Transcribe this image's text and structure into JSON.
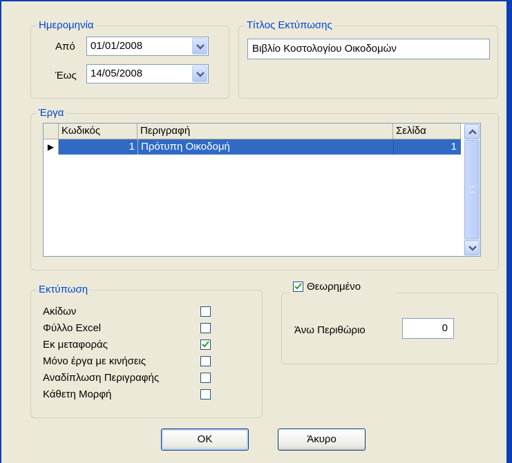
{
  "date_group": {
    "legend": "Ημερομηνία",
    "from_label": "Από",
    "from_value": "01/01/2008",
    "to_label": "Έως",
    "to_value": "14/05/2008"
  },
  "title_group": {
    "legend": "Τίτλος Εκτύπωσης",
    "value": "Βιβλίο Κοστολογίου Οικοδομών"
  },
  "projects_group": {
    "legend": "Έργα",
    "columns": [
      "Κωδικός",
      "Περιγραφή",
      "Σελίδα"
    ],
    "rows": [
      {
        "code": "1",
        "description": "Πρότυπη Οικοδομή",
        "page": "1"
      }
    ],
    "row_indicator": "▶"
  },
  "print_group": {
    "legend": "Εκτύπωση",
    "options": [
      {
        "label": "Ακίδων",
        "checked": false
      },
      {
        "label": "Φύλλο Excel",
        "checked": false
      },
      {
        "label": "Εκ μεταφοράς",
        "checked": true
      },
      {
        "label": "Μόνο έργα με κινήσεις",
        "checked": false
      },
      {
        "label": "Αναδίπλωση Περιγραφής",
        "checked": false
      },
      {
        "label": "Κάθετη Μορφή",
        "checked": false
      }
    ]
  },
  "endorsed_group": {
    "checkbox_label": "Θεωρημένο",
    "checked": true,
    "top_margin_label": "Άνω Περιθώριο",
    "top_margin_value": "0"
  },
  "buttons": {
    "ok": "OK",
    "cancel": "Άκυρο"
  },
  "colors": {
    "accent": "#0046d5",
    "selection": "#316ac5",
    "window_bg": "#ece9d8",
    "check": "#21a121"
  }
}
